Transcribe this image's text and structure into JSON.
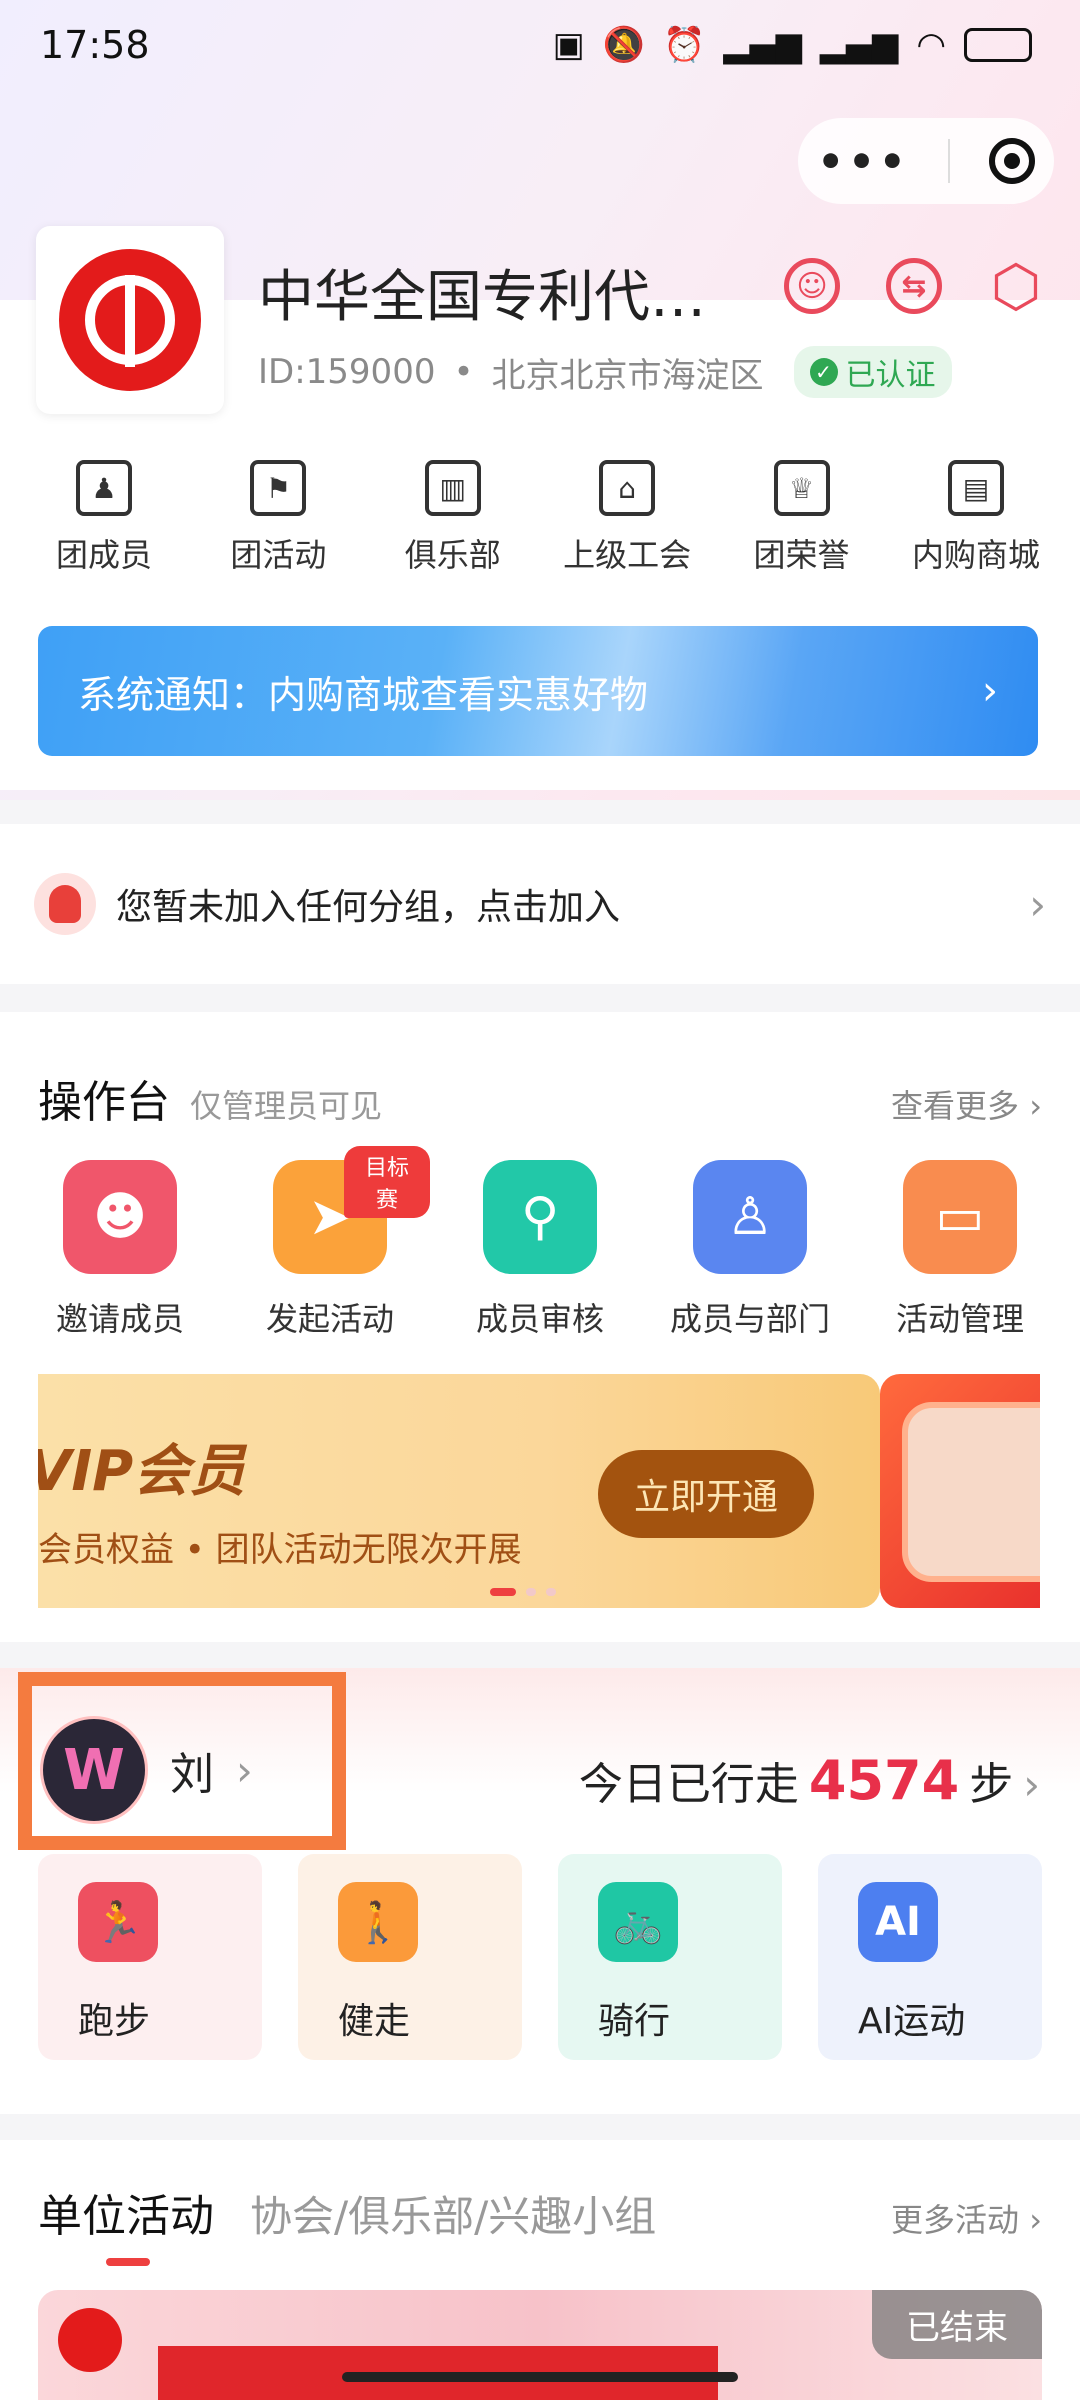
{
  "status_bar": {
    "time": "17:58",
    "icons": [
      "nfc-icon",
      "mute-icon",
      "alarm-icon",
      "signal-icon",
      "wifi-icon",
      "battery-icon"
    ]
  },
  "capsule": {
    "more_icon": "more-dots-icon",
    "close_icon": "target-icon"
  },
  "org": {
    "name": "中华全国专利代理…",
    "id_label": "ID:159000",
    "separator": "•",
    "location": "北京北京市海淀区",
    "verified_label": "已认证"
  },
  "header_icons": [
    "person-icon",
    "switch-icon",
    "settings-icon"
  ],
  "quick_nav": [
    {
      "label": "团成员",
      "icon": "members-icon"
    },
    {
      "label": "团活动",
      "icon": "flag-icon"
    },
    {
      "label": "俱乐部",
      "icon": "building-icon"
    },
    {
      "label": "上级工会",
      "icon": "bank-icon"
    },
    {
      "label": "团荣誉",
      "icon": "trophy-icon"
    },
    {
      "label": "内购商城",
      "icon": "store-icon"
    }
  ],
  "notice": {
    "text": "系统通知：内购商城查看实惠好物",
    "arrow": "›"
  },
  "group_prompt": {
    "text": "您暂未加入任何分组，点击加入",
    "arrow": "›"
  },
  "console": {
    "title": "操作台",
    "subtitle": "仅管理员可见",
    "more": "查看更多",
    "ops": [
      {
        "label": "邀请成员",
        "icon": "invite-icon",
        "color": "#f0566b"
      },
      {
        "label": "发起活动",
        "icon": "paper-plane-icon",
        "color": "#fba23a",
        "tag": "目标赛"
      },
      {
        "label": "成员审核",
        "icon": "stamp-icon",
        "color": "#22c8a8"
      },
      {
        "label": "成员与部门",
        "icon": "people-icon",
        "color": "#5a86f0"
      },
      {
        "label": "活动管理",
        "icon": "folder-icon",
        "color": "#f98c4f"
      }
    ],
    "vip_banner": {
      "title": "VIP会员",
      "subtitle": "会员权益 • 团队活动无限次开展",
      "button": "立即开通"
    }
  },
  "sport": {
    "user_name": "刘",
    "user_arrow": "›",
    "steps_prefix": "今日已行走",
    "steps_value": "4574",
    "steps_unit": "步",
    "modes": [
      {
        "label": "跑步",
        "icon": "run-icon",
        "color": "#ee5060",
        "bg": "#fdeff0"
      },
      {
        "label": "健走",
        "icon": "walk-icon",
        "color": "#fb9a3a",
        "bg": "#fdf1e6"
      },
      {
        "label": "骑行",
        "icon": "bike-icon",
        "color": "#1fc7a4",
        "bg": "#e6f8f2"
      },
      {
        "label": "AI运动",
        "icon": "ai-icon",
        "color": "#4d7ff0",
        "bg": "#eef2fc"
      }
    ]
  },
  "activities": {
    "tab_unit": "单位活动",
    "tab_other": "协会/俱乐部/兴趣小组",
    "more": "更多活动",
    "card_status": "已结束"
  }
}
